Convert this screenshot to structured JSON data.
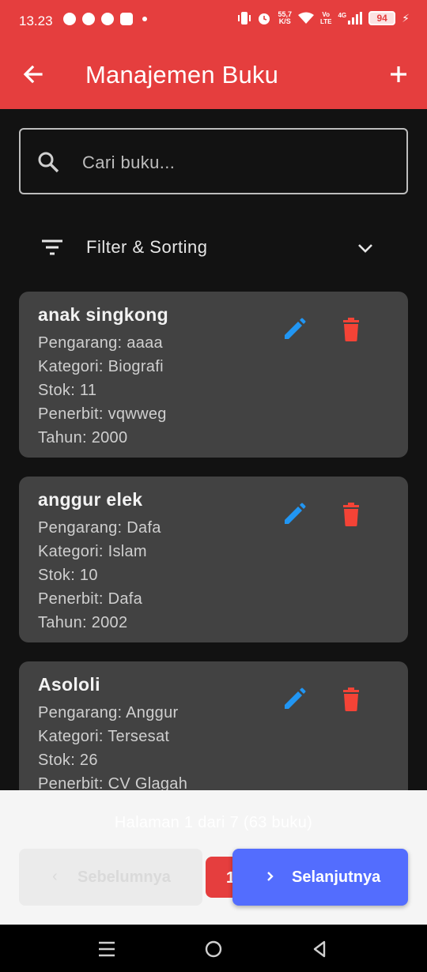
{
  "status_bar": {
    "time": "13.23",
    "net_speed_value": "55,7",
    "net_speed_unit": "K/S",
    "volte_top": "Vo",
    "volte_bottom": "LTE",
    "network": "4G",
    "battery": "94"
  },
  "app_bar": {
    "title": "Manajemen Buku",
    "color": "#E53E3E"
  },
  "search": {
    "placeholder": "Cari buku..."
  },
  "filter": {
    "label": "Filter & Sorting"
  },
  "books": [
    {
      "title": "anak singkong",
      "pengarang": "Pengarang: aaaa",
      "kategori": "Kategori: Biografi",
      "stok": "Stok: 11",
      "penerbit": "Penerbit: vqwweg",
      "tahun": "Tahun: 2000"
    },
    {
      "title": "anggur elek",
      "pengarang": "Pengarang: Dafa",
      "kategori": "Kategori: Islam",
      "stok": "Stok: 10",
      "penerbit": "Penerbit: Dafa",
      "tahun": "Tahun: 2002"
    },
    {
      "title": "Asololi",
      "pengarang": "Pengarang: Anggur",
      "kategori": "Kategori: Tersesat",
      "stok": "Stok: 26",
      "penerbit": "Penerbit: CV Glagah",
      "tahun": ""
    }
  ],
  "pagination": {
    "info": "Halaman 1 dari 7 (63 buku)",
    "prev_label": "Sebelumnya",
    "current_page": "1",
    "next_label": "Selanjutnya",
    "next_color": "#536DFE"
  },
  "colors": {
    "edit_icon": "#2196F3",
    "delete_icon": "#F44336"
  }
}
